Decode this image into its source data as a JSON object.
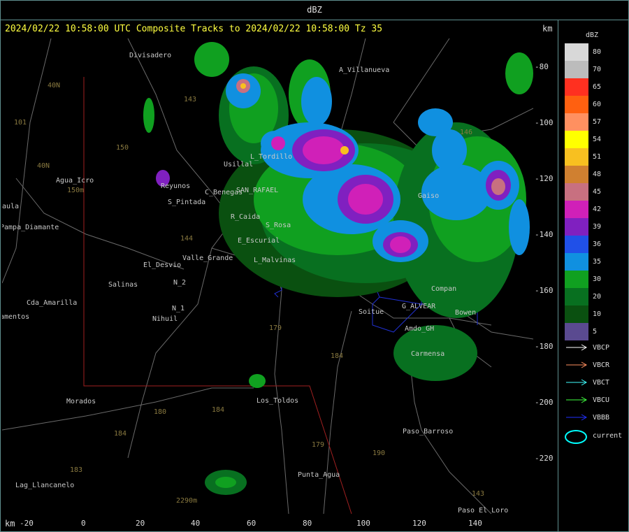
{
  "window": {
    "title": "dBZ"
  },
  "header": {
    "subtitle": "2024/02/22 10:58:00 UTC Composite Tracks to 2024/02/22 10:58:00 Tz 35",
    "km_top": "km",
    "km_bottom": "km"
  },
  "axes": {
    "y_ticks": [
      "-80",
      "-100",
      "-120",
      "-140",
      "-160",
      "-180",
      "-200",
      "-220"
    ],
    "x_ticks": [
      "-20",
      "0",
      "20",
      "40",
      "60",
      "80",
      "100",
      "120",
      "140"
    ]
  },
  "legend": {
    "title": "dBZ",
    "scale": [
      {
        "label": "80",
        "color": "#d8d8d8"
      },
      {
        "label": "70",
        "color": "#bcbcbc"
      },
      {
        "label": "65",
        "color": "#ff3020"
      },
      {
        "label": "60",
        "color": "#ff6010"
      },
      {
        "label": "57",
        "color": "#ff9060"
      },
      {
        "label": "54",
        "color": "#ffff00"
      },
      {
        "label": "51",
        "color": "#f8c020"
      },
      {
        "label": "48",
        "color": "#d08030"
      },
      {
        "label": "45",
        "color": "#c87080"
      },
      {
        "label": "42",
        "color": "#d020b8"
      },
      {
        "label": "39",
        "color": "#8020c0"
      },
      {
        "label": "36",
        "color": "#2050e8"
      },
      {
        "label": "35",
        "color": "#1090e0"
      },
      {
        "label": "30",
        "color": "#10a020"
      },
      {
        "label": "20",
        "color": "#087020"
      },
      {
        "label": "10",
        "color": "#0a5010"
      },
      {
        "label": "5",
        "color": "#5a4a90"
      }
    ],
    "tracks": [
      {
        "label": "VBCP",
        "color": "#ffffff"
      },
      {
        "label": "VBCR",
        "color": "#ff9060"
      },
      {
        "label": "VBCT",
        "color": "#40ffff"
      },
      {
        "label": "VBCU",
        "color": "#40ff40"
      },
      {
        "label": "VBBB",
        "color": "#2030ff"
      }
    ],
    "current_label": "current"
  },
  "places": [
    {
      "name": "Divisadero"
    },
    {
      "name": "A_Villanueva"
    },
    {
      "name": "Agua_Icro"
    },
    {
      "name": "aula"
    },
    {
      "name": "Pampa_Diamante"
    },
    {
      "name": "Reyunos"
    },
    {
      "name": "S_Pintada"
    },
    {
      "name": "Usillal"
    },
    {
      "name": "SAN_RAFAEL"
    },
    {
      "name": "R_Caida"
    },
    {
      "name": "E_Escurial"
    },
    {
      "name": "L_Malvinas"
    },
    {
      "name": "Valle_Grande"
    },
    {
      "name": "El_Desvio"
    },
    {
      "name": "Salinas"
    },
    {
      "name": "N_2"
    },
    {
      "name": "N_1"
    },
    {
      "name": "Nihuil"
    },
    {
      "name": "Cda_Amarilla"
    },
    {
      "name": "amentos"
    },
    {
      "name": "Soitue"
    },
    {
      "name": "G_ALVEAR"
    },
    {
      "name": "Bowen"
    },
    {
      "name": "Amdo_GH"
    },
    {
      "name": "Carmensa"
    },
    {
      "name": "Compan"
    },
    {
      "name": "Los_Toldos"
    },
    {
      "name": "Morados"
    },
    {
      "name": "Paso_Barroso"
    },
    {
      "name": "Punta_Agua"
    },
    {
      "name": "Lag_Llancanelo"
    },
    {
      "name": "Paso_El_Loro"
    },
    {
      "name": "S_Rosa"
    },
    {
      "name": "C_Benegas"
    },
    {
      "name": "L_Tordillo"
    },
    {
      "name": "Gaiso"
    }
  ],
  "roads": [
    "101",
    "40N",
    "40N",
    "150",
    "143",
    "146",
    "144",
    "179",
    "184",
    "180",
    "184",
    "184",
    "183",
    "179",
    "190",
    "143",
    "2290m",
    "150m"
  ]
}
